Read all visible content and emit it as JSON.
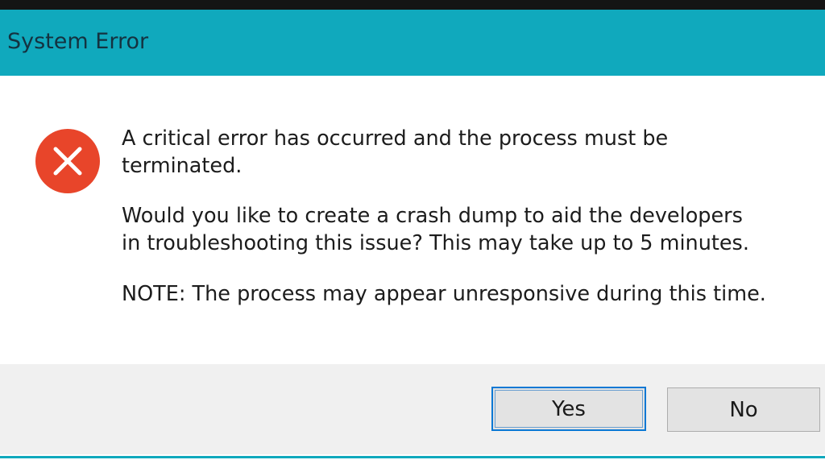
{
  "window": {
    "title": "System Error"
  },
  "icon": {
    "name": "error-icon",
    "color": "#e8452a"
  },
  "message": {
    "line1": "A critical error has occurred and the process must be\nterminated.",
    "line2": "Would you like to create a crash dump to aid the developers\nin troubleshooting this issue? This may take up to 5 minutes.",
    "line3": "NOTE: The process may appear unresponsive during this time."
  },
  "buttons": {
    "yes_label": "Yes",
    "no_label": "No"
  },
  "colors": {
    "title_bar": "#10a9bd",
    "focus_border": "#0a78d4"
  }
}
